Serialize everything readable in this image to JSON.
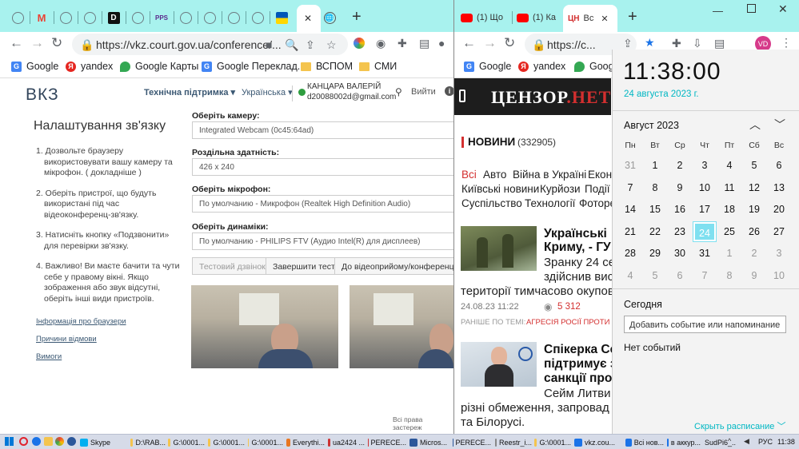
{
  "left_window": {
    "tabs": [
      {
        "icon": "chrome-icon"
      },
      {
        "icon": "gmail-icon"
      },
      {
        "icon": "chrome-icon"
      },
      {
        "icon": "chrome-icon"
      },
      {
        "icon": "d-icon",
        "text": "D"
      },
      {
        "icon": "chrome-icon"
      },
      {
        "icon": "pps-icon",
        "text": "PPS"
      },
      {
        "icon": "chrome-icon"
      },
      {
        "icon": "chrome-icon"
      },
      {
        "icon": "chrome-icon"
      },
      {
        "icon": "chrome-icon"
      },
      {
        "icon": "ukraine-icon"
      }
    ],
    "active_tab_close": "✕",
    "new_tab": "+",
    "url": "https://vkz.court.gov.ua/conference/...",
    "bookmarks": [
      "Google",
      "yandex",
      "Google Карты",
      "Google Переклад...",
      "ВСПОМ",
      "СМИ"
    ],
    "page": {
      "logo": "ВКЗ",
      "support": "Технічна підтримка ▾",
      "language": "Українська ▾",
      "user_name": "КАНЦАРА ВАЛЕРІЙ",
      "user_email": "d20088002d@gmail.com",
      "logout": "Вийти",
      "title": "Налаштування зв'язку",
      "steps": [
        "1. Дозвольте браузеру використовувати вашу камеру та мікрофон. ( докладніше )",
        "2. Оберіть пристрої, що будуть використані під час відеоконференц-зв'язку.",
        "3. Натисніть кнопку «Подзвонити» для перевірки зв'язку.",
        "4. Важливо! Ви маєте бачити та чути себе у правому вікні. Якщо зображення або звук відсутні, оберіть інші види пристроїв."
      ],
      "links": [
        "Інформація про браузери",
        "Причини відмови",
        "Вимоги"
      ],
      "camera_label": "Оберіть камеру:",
      "camera_value": "Integrated Webcam (0c45:64ad)",
      "resolution_label": "Роздільна здатність:",
      "resolution_value": "426 x 240",
      "mic_label": "Оберіть мікрофон:",
      "mic_value": "По умолчанию - Микрофон (Realtek High Definition Audio)",
      "speaker_label": "Оберіть динаміки:",
      "speaker_value": "По умолчанию - PHILIPS FTV (Аудио Intel(R) для дисплеев)",
      "btn_test": "Тестовий дзвінок",
      "btn_finish": "Завершити тест",
      "btn_go": "До відеоприйому/конференції",
      "footer": "Всі права застереж"
    }
  },
  "right_window": {
    "tabs": [
      {
        "title": "(1) Що",
        "icon": "youtube-icon"
      },
      {
        "title": "(1) Ка",
        "icon": "youtube-icon"
      },
      {
        "title": "Вс",
        "icon": "censor-icon",
        "badge": "ЦН"
      }
    ],
    "url": "https://c...",
    "avatar": "VD",
    "bookmarks": [
      "Google",
      "yandex",
      "Googl"
    ],
    "page": {
      "logo_a": "ЦЕНЗОР",
      "logo_b": ".НЕТ",
      "section": "НОВИНИ",
      "count": "(332905)",
      "cats_row1": [
        "Всі",
        "Авто",
        "Війна в Україні",
        "Еконо"
      ],
      "cats_row2": [
        "Київські новини",
        "Курйози",
        "Події"
      ],
      "cats_row3": [
        "Суспільство",
        "Технології",
        "Фоторе"
      ],
      "news1_title": "Українські ... Криму, - ГУ",
      "news1_t1": "Українські",
      "news1_t2": "Криму, - ГУ",
      "news1_lead1": "Зранку 24 се",
      "news1_lead2": "здійснив вис",
      "news1_lead3": "території тимчасово окупов",
      "news1_date": "24.08.23 11:22",
      "news1_views": "5 312",
      "news1_related_label": "РАНІШЕ ПО ТЕМІ:",
      "news1_related": "АГРЕСІЯ РОСІЇ ПРОТИ У",
      "news2_t1": "Спікерка Се",
      "news2_t2": "підтримує з",
      "news2_t3": "санкції прот",
      "news2_lead1": "Сейм Литви",
      "news2_lead2": "різні обмеження, запровад",
      "news2_lead3": "та Білорусі."
    }
  },
  "calendar": {
    "time": "11:38:00",
    "date": "24 августа 2023 г.",
    "month": "Август 2023",
    "weekdays": [
      "Пн",
      "Вт",
      "Ср",
      "Чт",
      "Пт",
      "Сб",
      "Вс"
    ],
    "days": [
      [
        "31",
        "1",
        "2",
        "3",
        "4",
        "5",
        "6"
      ],
      [
        "7",
        "8",
        "9",
        "10",
        "11",
        "12",
        "13"
      ],
      [
        "14",
        "15",
        "16",
        "17",
        "18",
        "19",
        "20"
      ],
      [
        "21",
        "22",
        "23",
        "24",
        "25",
        "26",
        "27"
      ],
      [
        "28",
        "29",
        "30",
        "31",
        "1",
        "2",
        "3"
      ],
      [
        "4",
        "5",
        "6",
        "7",
        "8",
        "9",
        "10"
      ]
    ],
    "today": "24",
    "today_label": "Сегодня",
    "add_event": "Добавить событие или напоминание",
    "no_events": "Нет событий",
    "hide_schedule": "Скрыть расписание"
  },
  "taskbar": {
    "items": [
      {
        "label": "Skype",
        "color": "#00aff0"
      },
      {
        "label": "D:\\RAB...",
        "color": "#f4c44e"
      },
      {
        "label": "G:\\0001...",
        "color": "#f4c44e"
      },
      {
        "label": "G:\\0001...",
        "color": "#f4c44e"
      },
      {
        "label": "G:\\0001...",
        "color": "#f4c44e"
      },
      {
        "label": "Everythi...",
        "color": "#e87722"
      },
      {
        "label": "ua2424 ...",
        "color": "#c33"
      },
      {
        "label": "PERECE...",
        "color": "#c33"
      },
      {
        "label": "Micros...",
        "color": "#2b579a"
      },
      {
        "label": "PERECE...",
        "color": "#2b579a"
      },
      {
        "label": "Reestr_i...",
        "color": "#888"
      },
      {
        "label": "G:\\0001...",
        "color": "#f4c44e"
      },
      {
        "label": "vkz.cou...",
        "color": "#1a73e8"
      },
      {
        "label": "Всі нов...",
        "color": "#1a73e8"
      },
      {
        "label": "в аккур...",
        "color": "#1a73e8"
      },
      {
        "label": "SudPi6_...",
        "color": "#c33"
      }
    ],
    "lang": "РУС",
    "clock": "11:38"
  },
  "colors": {
    "tabbar": "#a8f2ee",
    "accent": "#00b7c3",
    "censor_red": "#d32f2f"
  }
}
